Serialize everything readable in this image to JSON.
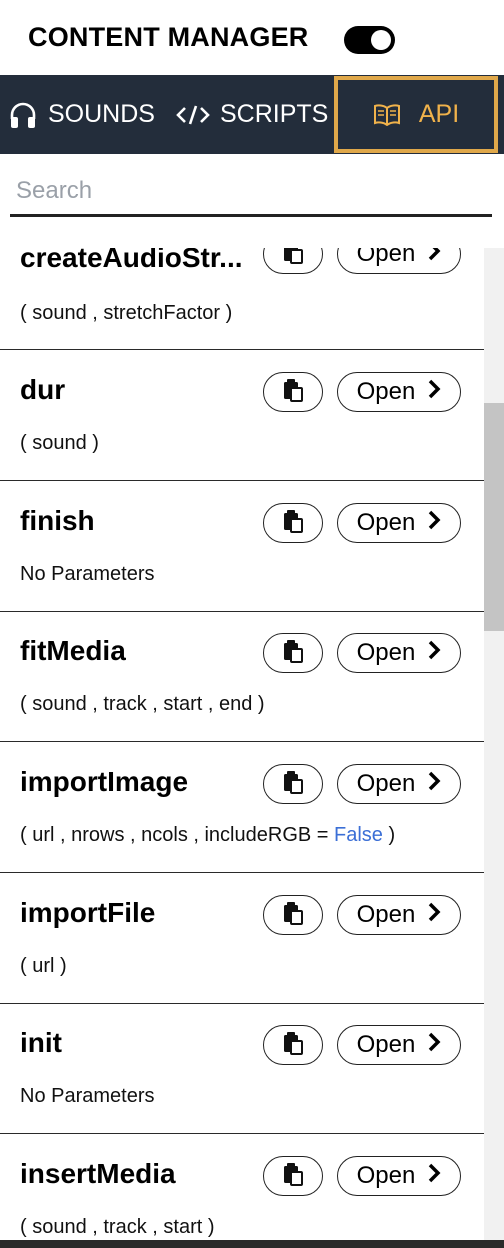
{
  "header": {
    "title": "CONTENT MANAGER",
    "toggle_on": true
  },
  "tabs": [
    {
      "label": "SOUNDS",
      "icon": "headphones-icon",
      "active": false
    },
    {
      "label": "SCRIPTS",
      "icon": "code-icon",
      "active": false
    },
    {
      "label": "API",
      "icon": "book-open-icon",
      "active": true
    }
  ],
  "colors": {
    "tabbar_bg": "#232d3b",
    "active_accent": "#e0a84a",
    "keyword": "#3b6fd6"
  },
  "search": {
    "placeholder": "Search",
    "value": ""
  },
  "api_items": [
    {
      "name": "createAudioStr...",
      "params": "( sound , stretchFactor )",
      "open_label": "Open"
    },
    {
      "name": "dur",
      "params": "( sound )",
      "open_label": "Open"
    },
    {
      "name": "finish",
      "params": "No Parameters",
      "open_label": "Open"
    },
    {
      "name": "fitMedia",
      "params": "( sound , track , start , end )",
      "open_label": "Open"
    },
    {
      "name": "importImage",
      "params_prefix": "( url , nrows , ncols , includeRGB = ",
      "params_default": "False",
      "params_suffix": " )",
      "open_label": "Open"
    },
    {
      "name": "importFile",
      "params": "( url )",
      "open_label": "Open"
    },
    {
      "name": "init",
      "params": "No Parameters",
      "open_label": "Open"
    },
    {
      "name": "insertMedia",
      "params": "( sound , track , start )",
      "open_label": "Open"
    }
  ]
}
